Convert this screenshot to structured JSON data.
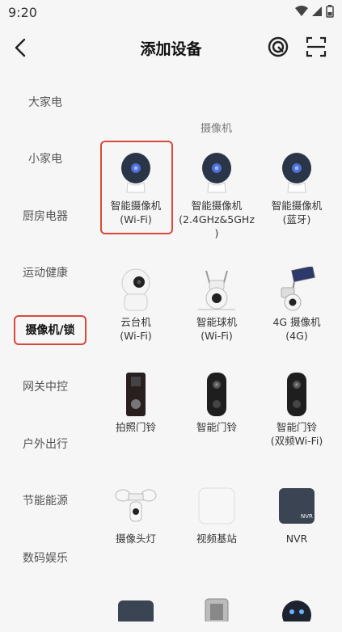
{
  "status": {
    "time": "9:20"
  },
  "header": {
    "title": "添加设备"
  },
  "sidebar": {
    "items": [
      {
        "label": "大家电",
        "active": false
      },
      {
        "label": "小家电",
        "active": false
      },
      {
        "label": "厨房电器",
        "active": false
      },
      {
        "label": "运动健康",
        "active": false
      },
      {
        "label": "摄像机/锁",
        "active": true
      },
      {
        "label": "网关中控",
        "active": false
      },
      {
        "label": "户外出行",
        "active": false
      },
      {
        "label": "节能能源",
        "active": false
      },
      {
        "label": "数码娱乐",
        "active": false
      }
    ]
  },
  "section": {
    "title": "摄像机"
  },
  "devices": [
    {
      "line1": "智能摄像机",
      "line2": "(Wi-Fi)",
      "line3": "",
      "icon": "camera-icon"
    },
    {
      "line1": "智能摄像机",
      "line2": "(2.4GHz&5GHz",
      "line3": ")",
      "icon": "camera-icon"
    },
    {
      "line1": "智能摄像机",
      "line2": "(蓝牙)",
      "line3": "",
      "icon": "camera-icon"
    },
    {
      "line1": "云台机",
      "line2": "(Wi-Fi)",
      "line3": "",
      "icon": "ptz-camera-icon"
    },
    {
      "line1": "智能球机",
      "line2": "(Wi-Fi)",
      "line3": "",
      "icon": "dome-camera-icon"
    },
    {
      "line1": "4G 摄像机",
      "line2": "(4G)",
      "line3": "",
      "icon": "solar-camera-icon"
    },
    {
      "line1": "拍照门铃",
      "line2": "",
      "line3": "",
      "icon": "photo-doorbell-icon"
    },
    {
      "line1": "智能门铃",
      "line2": "",
      "line3": "",
      "icon": "doorbell-icon"
    },
    {
      "line1": "智能门铃",
      "line2": "(双频Wi-Fi)",
      "line3": "",
      "icon": "doorbell-icon"
    },
    {
      "line1": "摄像头灯",
      "line2": "",
      "line3": "",
      "icon": "floodlight-camera-icon"
    },
    {
      "line1": "视频基站",
      "line2": "",
      "line3": "",
      "icon": "base-station-icon"
    },
    {
      "line1": "NVR",
      "line2": "",
      "line3": "",
      "icon": "nvr-icon",
      "badge": "NVR"
    }
  ],
  "colors": {
    "accent": "#d9483b",
    "background": "#f6f6f6"
  }
}
